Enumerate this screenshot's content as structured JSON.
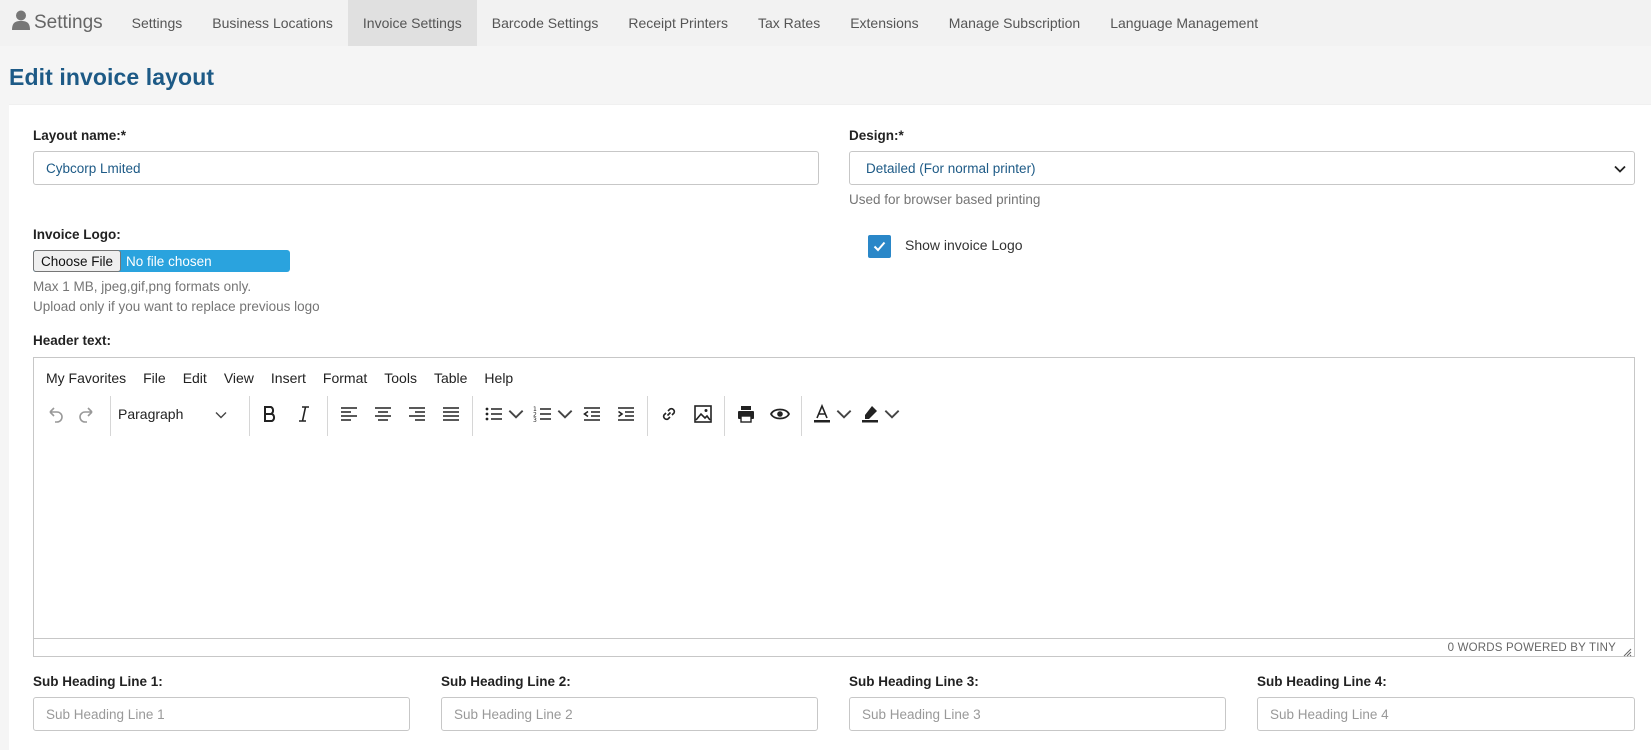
{
  "nav": {
    "brand": "Settings",
    "brand_icon": "user-icon",
    "tabs": [
      {
        "label": "Settings",
        "active": false
      },
      {
        "label": "Business Locations",
        "active": false
      },
      {
        "label": "Invoice Settings",
        "active": true
      },
      {
        "label": "Barcode Settings",
        "active": false
      },
      {
        "label": "Receipt Printers",
        "active": false
      },
      {
        "label": "Tax Rates",
        "active": false
      },
      {
        "label": "Extensions",
        "active": false
      },
      {
        "label": "Manage Subscription",
        "active": false
      },
      {
        "label": "Language Management",
        "active": false
      }
    ]
  },
  "page": {
    "title": "Edit invoice layout"
  },
  "form": {
    "layout_name_label": "Layout name:*",
    "layout_name_value": "Cybcorp Lmited",
    "design_label": "Design:*",
    "design_value": "Detailed (For normal printer)",
    "design_help": "Used for browser based printing",
    "logo_label": "Invoice Logo:",
    "file_button": "Choose File",
    "file_status": "No file chosen",
    "logo_help_1": "Max 1 MB, jpeg,gif,png formats only.",
    "logo_help_2": "Upload only if you want to replace previous logo",
    "show_logo_label": "Show invoice Logo",
    "show_logo_checked": true,
    "header_text_label": "Header text:"
  },
  "editor": {
    "menu": [
      "My Favorites",
      "File",
      "Edit",
      "View",
      "Insert",
      "Format",
      "Tools",
      "Table",
      "Help"
    ],
    "block_format": "Paragraph",
    "status": "0 WORDS  POWERED BY TINY"
  },
  "subheadings": [
    {
      "label": "Sub Heading Line 1:",
      "placeholder": "Sub Heading Line 1"
    },
    {
      "label": "Sub Heading Line 2:",
      "placeholder": "Sub Heading Line 2"
    },
    {
      "label": "Sub Heading Line 3:",
      "placeholder": "Sub Heading Line 3"
    },
    {
      "label": "Sub Heading Line 4:",
      "placeholder": "Sub Heading Line 4"
    }
  ],
  "colors": {
    "accent": "#2a87c8",
    "title": "#1d5a86",
    "file_bg": "#2aa3de"
  }
}
